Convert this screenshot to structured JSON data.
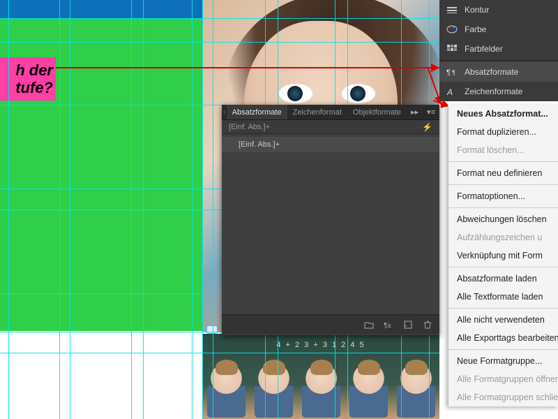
{
  "canvas": {
    "text_line1": "h der",
    "text_line2": "tufe?",
    "chalk_text": "4 + 2   3 + 3   1 2 4 5"
  },
  "rail": {
    "items": [
      {
        "label": "Kontur",
        "icon": "stroke-icon"
      },
      {
        "label": "Farbe",
        "icon": "color-icon"
      },
      {
        "label": "Farbfelder",
        "icon": "swatches-icon"
      },
      {
        "label": "Absatzformate",
        "icon": "paragraph-styles-icon",
        "active": true
      },
      {
        "label": "Zeichenformate",
        "icon": "character-styles-icon"
      }
    ]
  },
  "panel": {
    "tabs": {
      "t1": "Absatzformate",
      "t2": "Zeichenformat",
      "t3": "Objektformate"
    },
    "status": "[Einf. Abs.]+",
    "list": {
      "item1": "[Einf. Abs.]+"
    },
    "collapse_glyph": "▸▸",
    "menu_glyph": "▾≡"
  },
  "context_menu": {
    "i1": "Neues Absatzformat...",
    "i2": "Format duplizieren...",
    "i3": "Format löschen...",
    "i4": "Format neu definieren",
    "i5": "Formatoptionen...",
    "i6": "Abweichungen löschen",
    "i7": "Aufzählungszeichen u",
    "i8": "Verknüpfung mit Form",
    "i9": "Absatzformate laden",
    "i10": "Alle Textformate laden",
    "i11": "Alle nicht verwendeten",
    "i12": "Alle Exporttags bearbeiten",
    "i13": "Neue Formatgruppe...",
    "i14": "Alle Formatgruppen öffnen",
    "i15": "Alle Formatgruppen schließen"
  }
}
